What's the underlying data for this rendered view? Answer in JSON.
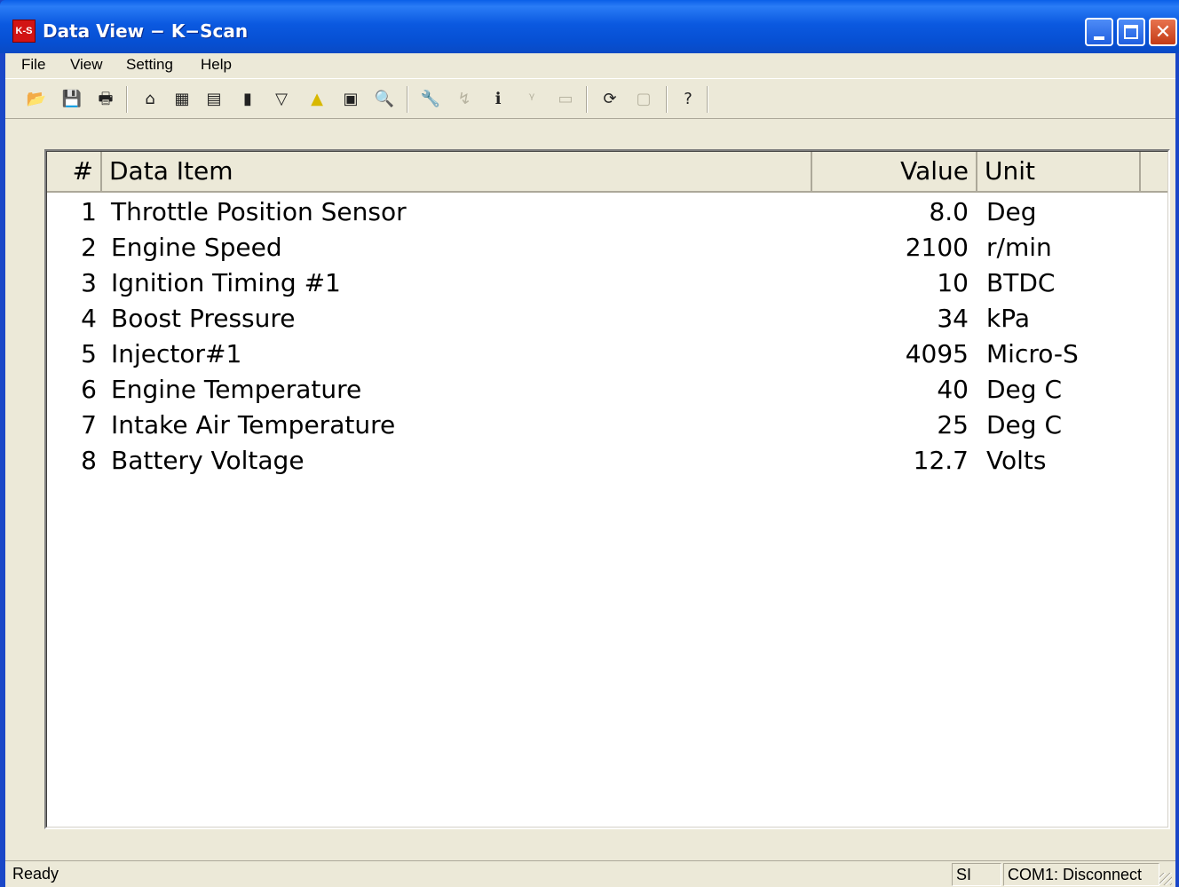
{
  "window": {
    "title": "Data View − K−Scan",
    "app_icon_label": "K-S"
  },
  "menu": {
    "items": [
      "File",
      "View",
      "Setting",
      "Help"
    ]
  },
  "toolbar": {
    "icons": [
      "open-icon",
      "save-icon",
      "print-icon",
      "home-icon",
      "grid-icon",
      "table-icon",
      "bar-chart-icon",
      "filter-icon",
      "warning-icon",
      "record-icon",
      "preview-icon",
      "wrench-icon",
      "test-icon",
      "info-icon",
      "signal-icon",
      "output-icon",
      "refresh-icon",
      "window-icon",
      "help-icon"
    ]
  },
  "table": {
    "headers": {
      "num": "#",
      "item": "Data Item",
      "value": "Value",
      "unit": "Unit"
    },
    "rows": [
      {
        "num": "1",
        "item": "Throttle Position Sensor",
        "value": "8.0",
        "unit": "Deg"
      },
      {
        "num": "2",
        "item": "Engine Speed",
        "value": "2100",
        "unit": "r/min"
      },
      {
        "num": "3",
        "item": "Ignition Timing #1",
        "value": "10",
        "unit": "BTDC"
      },
      {
        "num": "4",
        "item": "Boost Pressure",
        "value": "34",
        "unit": "kPa"
      },
      {
        "num": "5",
        "item": "Injector#1",
        "value": "4095",
        "unit": "Micro-S"
      },
      {
        "num": "6",
        "item": "Engine Temperature",
        "value": "40",
        "unit": "Deg C"
      },
      {
        "num": "7",
        "item": "Intake Air Temperature",
        "value": "25",
        "unit": "Deg C"
      },
      {
        "num": "8",
        "item": "Battery Voltage",
        "value": "12.7",
        "unit": "Volts"
      }
    ]
  },
  "statusbar": {
    "text": "Ready",
    "panel_unit": "SI",
    "panel_port": "COM1: Disconnect"
  },
  "colors": {
    "titlebar": "#0b59e0",
    "face": "#ece9d8",
    "close_button": "#c33b16"
  }
}
